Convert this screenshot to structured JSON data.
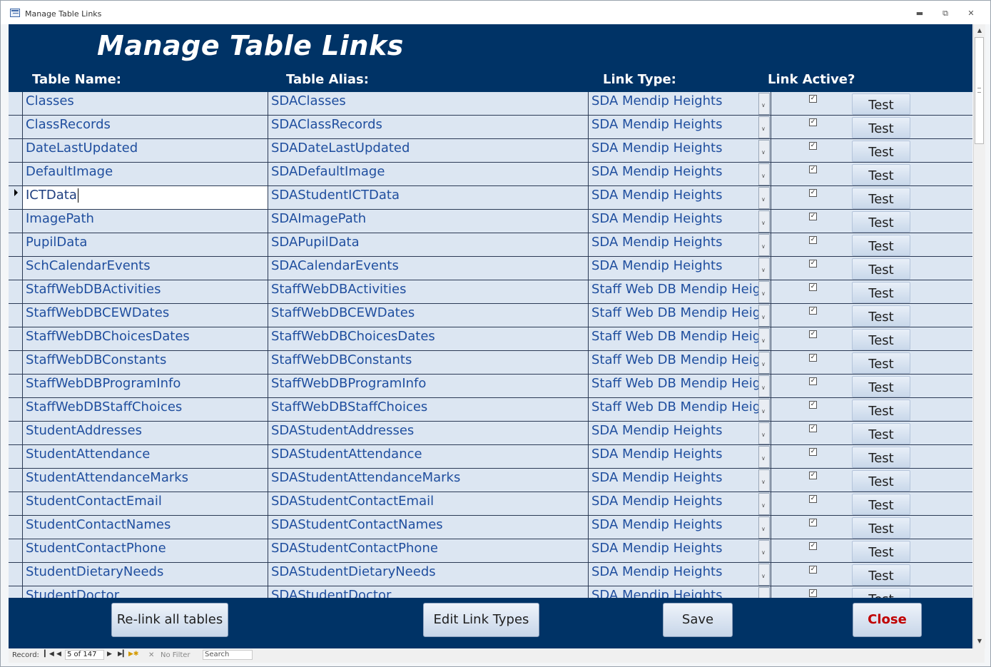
{
  "window": {
    "title": "Manage Table Links"
  },
  "form": {
    "heading": "Manage Table Links",
    "columns": {
      "name": "Table Name:",
      "alias": "Table Alias:",
      "type": "Link Type:",
      "active": "Link Active?"
    },
    "test_label": "Test",
    "current_row": 4,
    "rows": [
      {
        "name": "Classes",
        "alias": "SDAClasses",
        "type": "SDA Mendip Heights",
        "active": true
      },
      {
        "name": "ClassRecords",
        "alias": "SDAClassRecords",
        "type": "SDA Mendip Heights",
        "active": true
      },
      {
        "name": "DateLastUpdated",
        "alias": "SDADateLastUpdated",
        "type": "SDA Mendip Heights",
        "active": true
      },
      {
        "name": "DefaultImage",
        "alias": "SDADefaultImage",
        "type": "SDA Mendip Heights",
        "active": true
      },
      {
        "name": "ICTData",
        "alias": "SDAStudentICTData",
        "type": "SDA Mendip Heights",
        "active": true
      },
      {
        "name": "ImagePath",
        "alias": "SDAImagePath",
        "type": "SDA Mendip Heights",
        "active": true
      },
      {
        "name": "PupilData",
        "alias": "SDAPupilData",
        "type": "SDA Mendip Heights",
        "active": true
      },
      {
        "name": "SchCalendarEvents",
        "alias": "SDACalendarEvents",
        "type": "SDA Mendip Heights",
        "active": true
      },
      {
        "name": "StaffWebDBActivities",
        "alias": "StaffWebDBActivities",
        "type": "Staff Web DB Mendip Heights",
        "active": true
      },
      {
        "name": "StaffWebDBCEWDates",
        "alias": "StaffWebDBCEWDates",
        "type": "Staff Web DB Mendip Heights",
        "active": true
      },
      {
        "name": "StaffWebDBChoicesDates",
        "alias": "StaffWebDBChoicesDates",
        "type": "Staff Web DB Mendip Heights",
        "active": true
      },
      {
        "name": "StaffWebDBConstants",
        "alias": "StaffWebDBConstants",
        "type": "Staff Web DB Mendip Heights",
        "active": true
      },
      {
        "name": "StaffWebDBProgramInfo",
        "alias": "StaffWebDBProgramInfo",
        "type": "Staff Web DB Mendip Heights",
        "active": true
      },
      {
        "name": "StaffWebDBStaffChoices",
        "alias": "StaffWebDBStaffChoices",
        "type": "Staff Web DB Mendip Heights",
        "active": true
      },
      {
        "name": "StudentAddresses",
        "alias": "SDAStudentAddresses",
        "type": "SDA Mendip Heights",
        "active": true
      },
      {
        "name": "StudentAttendance",
        "alias": "SDAStudentAttendance",
        "type": "SDA Mendip Heights",
        "active": true
      },
      {
        "name": "StudentAttendanceMarks",
        "alias": "SDAStudentAttendanceMarks",
        "type": "SDA Mendip Heights",
        "active": true
      },
      {
        "name": "StudentContactEmail",
        "alias": "SDAStudentContactEmail",
        "type": "SDA Mendip Heights",
        "active": true
      },
      {
        "name": "StudentContactNames",
        "alias": "SDAStudentContactNames",
        "type": "SDA Mendip Heights",
        "active": true
      },
      {
        "name": "StudentContactPhone",
        "alias": "SDAStudentContactPhone",
        "type": "SDA Mendip Heights",
        "active": true
      },
      {
        "name": "StudentDietaryNeeds",
        "alias": "SDAStudentDietaryNeeds",
        "type": "SDA Mendip Heights",
        "active": true
      },
      {
        "name": "StudentDoctor",
        "alias": "SDAStudentDoctor",
        "type": "SDA Mendip Heights",
        "active": true
      }
    ]
  },
  "buttons": {
    "relink": "Re-link all tables",
    "edit_types": "Edit Link Types",
    "save": "Save",
    "close": "Close"
  },
  "status": {
    "record_label": "Record:",
    "record_value": "5 of 147",
    "filter": "No Filter",
    "search": "Search"
  }
}
